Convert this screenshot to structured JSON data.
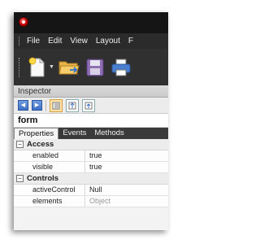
{
  "menubar": {
    "items": [
      "File",
      "Edit",
      "View",
      "Layout",
      "F"
    ]
  },
  "toolbar": {
    "buttons": [
      "new-document-icon",
      "open-folder-icon",
      "save-icon",
      "print-icon"
    ]
  },
  "inspector": {
    "title": "Inspector",
    "object_name": "form",
    "tabs": [
      "Properties",
      "Events",
      "Methods"
    ],
    "sections": [
      {
        "label": "Access",
        "toggle": "−",
        "rows": [
          {
            "name": "enabled",
            "value": "true"
          },
          {
            "name": "visible",
            "value": "true"
          }
        ]
      },
      {
        "label": "Controls",
        "toggle": "−",
        "rows": [
          {
            "name": "activeControl",
            "value": "Null"
          },
          {
            "name": "elements",
            "value": "Object"
          }
        ]
      }
    ]
  },
  "colors": {
    "titlebar": "#151515",
    "menubar": "#2b2b2b",
    "toolbar": "#303030",
    "accent_blue": "#3c6fc4",
    "app_badge": "#c40000"
  }
}
